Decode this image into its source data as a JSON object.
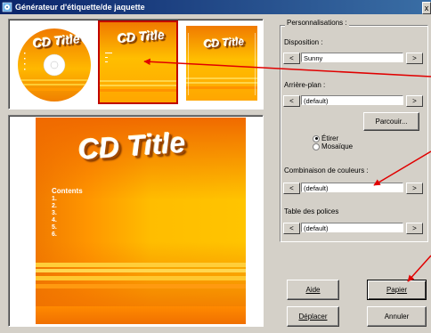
{
  "window": {
    "title": "Générateur d'étiquette/de jaquette",
    "close_glyph": "x"
  },
  "thumbnails": [
    {
      "name": "cd-disc",
      "title": "CD Title"
    },
    {
      "name": "booklet-front",
      "title": "CD Title",
      "selected": true
    },
    {
      "name": "back-cover",
      "title": "CD Title"
    }
  ],
  "preview": {
    "title": "CD Title",
    "contents_heading": "Contents",
    "contents_items": [
      "1.",
      "2.",
      "3.",
      "4.",
      "5.",
      "6."
    ]
  },
  "settings": {
    "group_label": "Personnalisations :",
    "layout": {
      "label": "Disposition :",
      "value": "Sunny",
      "prev": "<",
      "next": ">"
    },
    "background": {
      "label": "Arrière-plan :",
      "value": "(default)",
      "prev": "<",
      "next": ">",
      "browse": "Parcouir..."
    },
    "fit_options": [
      {
        "label": "Étirer",
        "checked": true
      },
      {
        "label": "Mosaïque",
        "checked": false
      }
    ],
    "color_scheme": {
      "label": "Combinaison de couleurs :",
      "value": "(default)",
      "prev": "<",
      "next": ">"
    },
    "font_table": {
      "label": "Table des polices",
      "value": "(default)",
      "prev": "<",
      "next": ">"
    }
  },
  "buttons": {
    "help": "Aide",
    "paper": "Papier",
    "move": "Déplacer",
    "cancel": "Annuler"
  },
  "colors": {
    "accent_red": "#e00000",
    "orange": "#f08000",
    "yellow": "#ffd000",
    "titlebar": "#0a246a"
  }
}
